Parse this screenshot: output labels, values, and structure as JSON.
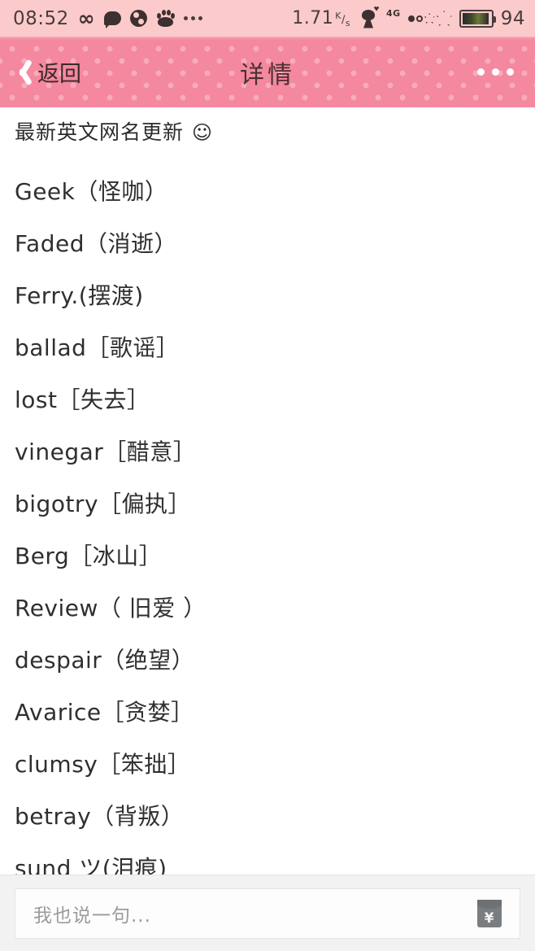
{
  "statusbar": {
    "time": "08:52",
    "icons_left": [
      "infinity-icon",
      "chat-bubble-icon",
      "yinyang-icon",
      "baidu-paw-icon",
      "more-dots-icon"
    ],
    "network_speed": "1.71",
    "network_speed_unit_top": "K",
    "network_speed_unit_bottom": "s",
    "icons_right": [
      "girl-avatar-icon",
      "4g-signal-icon",
      "flower-signal-icon"
    ],
    "signal_label": "4G",
    "battery_percent": "94"
  },
  "navbar": {
    "back_label": "返回",
    "title": "详情",
    "more_label": "···"
  },
  "post": {
    "title": "最新英文网名更新",
    "title_emoji": "☺",
    "lines": [
      "Geek（怪咖）",
      "Faded（消逝）",
      "Ferry.(摆渡)",
      "ballad［歌谣］",
      "lost［失去］",
      "vinegar［醋意］",
      "bigotry［偏执］",
      "Berg［冰山］",
      "Review（ 旧爱 ）",
      "despair（绝望）",
      "Avarice［贪婪］",
      "clumsy［笨拙］",
      "betray（背叛）",
      "sund ツ(泪痕)"
    ]
  },
  "commentbar": {
    "placeholder": "我也说一句...",
    "hongbao_symbol": "¥"
  },
  "colors": {
    "statusbar_bg": "#fbcbcb",
    "navbar_bg": "#f4889f",
    "navbar_dot": "#ffffff",
    "content_bg": "#ffffff",
    "text": "#2f2f2f",
    "commentbar_bg": "#f2f2f2",
    "placeholder": "#9b9b9b"
  }
}
